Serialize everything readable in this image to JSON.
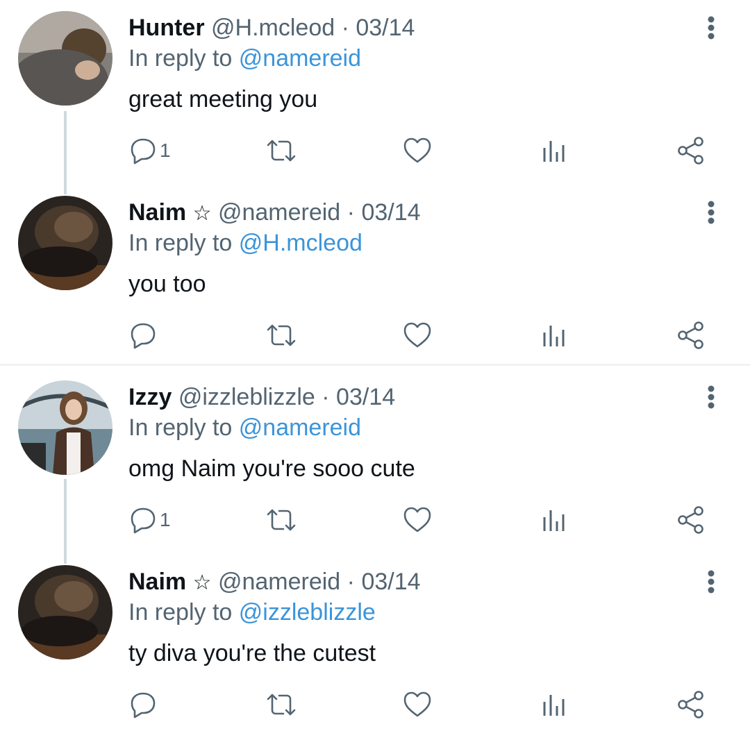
{
  "colors": {
    "text": "#0f1419",
    "secondary": "#536471",
    "link": "#3b94d9",
    "thread_line": "#cfd9de",
    "divider": "#eff3f4"
  },
  "tweets": [
    {
      "name": "Hunter",
      "name_suffix": "",
      "handle": "@H.mcleod",
      "date": "· 03/14",
      "reply_prefix": "In reply to",
      "reply_to": "@namereid",
      "text": "great meeting you",
      "reply_count": "1",
      "avatar": "hunter-avatar"
    },
    {
      "name": "Naim",
      "name_suffix": "☆",
      "handle": "@namereid",
      "date": "· 03/14",
      "reply_prefix": "In reply to",
      "reply_to": "@H.mcleod",
      "text": "you too",
      "reply_count": "",
      "avatar": "naim-avatar"
    },
    {
      "name": "Izzy",
      "name_suffix": "",
      "handle": "@izzleblizzle",
      "date": "· 03/14",
      "reply_prefix": "In reply to",
      "reply_to": "@namereid",
      "text": "omg Naim you're sooo cute",
      "reply_count": "1",
      "avatar": "izzy-avatar"
    },
    {
      "name": "Naim",
      "name_suffix": "☆",
      "handle": "@namereid",
      "date": "· 03/14",
      "reply_prefix": "In reply to",
      "reply_to": "@izzleblizzle",
      "text": "ty diva you're the cutest",
      "reply_count": "",
      "avatar": "naim-avatar"
    }
  ],
  "icons": {
    "reply": "reply-icon",
    "retweet": "retweet-icon",
    "like": "heart-icon",
    "views": "views-icon",
    "share": "share-icon",
    "more": "more-vertical-icon"
  }
}
